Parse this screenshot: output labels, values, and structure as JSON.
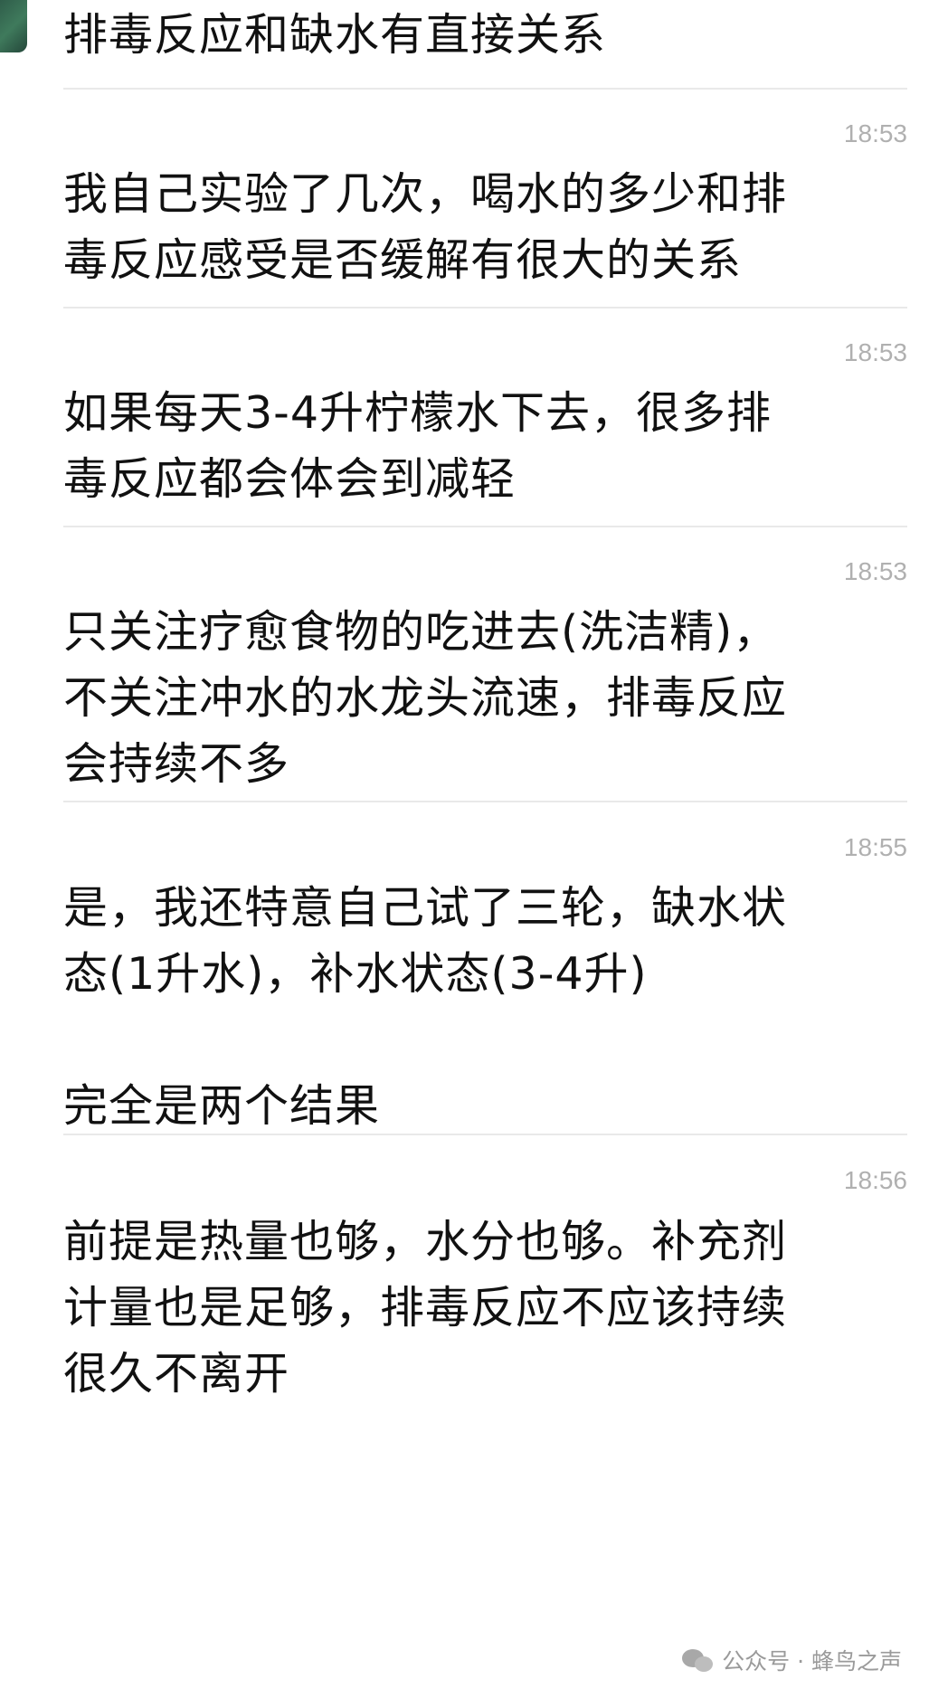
{
  "messages": [
    {
      "text": "排毒反应和缺水有直接关系"
    },
    {
      "time": "18:53",
      "text": "我自己实验了几次，喝水的多少和排\n毒反应感受是否缓解有很大的关系"
    },
    {
      "time": "18:53",
      "text": "如果每天3-4升柠檬水下去，很多排\n毒反应都会体会到减轻"
    },
    {
      "time": "18:53",
      "text": "只关注疗愈食物的吃进去(洗洁精)，\n不关注冲水的水龙头流速，排毒反应\n会持续不多"
    },
    {
      "time": "18:55",
      "text": "是，我还特意自己试了三轮，缺水状\n态(1升水)，补水状态(3-4升)\n\n完全是两个结果"
    },
    {
      "time": "18:56",
      "text": "前提是热量也够，水分也够。补充剂\n计量也是足够，排毒反应不应该持续\n很久不离开"
    }
  ],
  "watermark": {
    "icon": "wechat-icon",
    "text": "公众号 · 蜂鸟之声"
  }
}
